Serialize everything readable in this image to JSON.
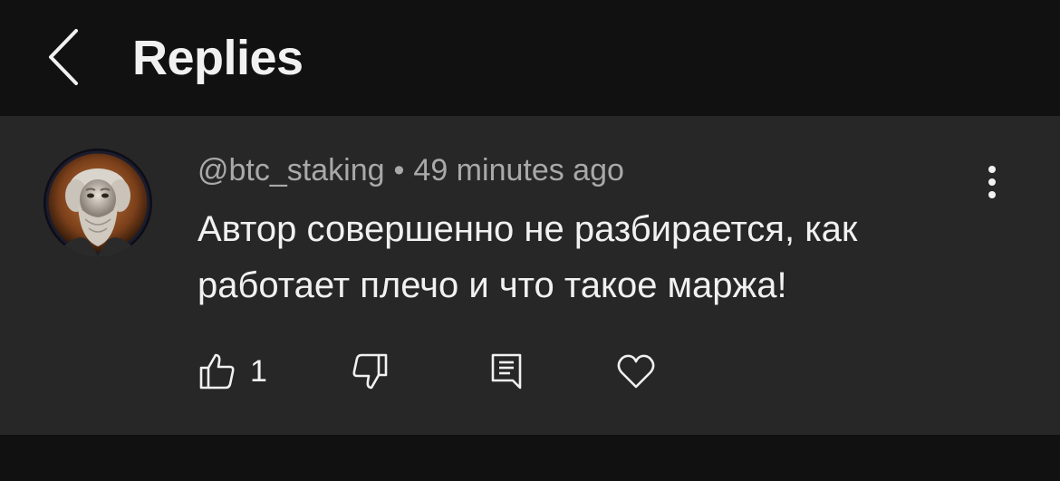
{
  "header": {
    "title": "Replies",
    "back_icon": "chevron-left-icon"
  },
  "comment": {
    "username": "@btc_staking",
    "separator": "•",
    "timestamp": "49 minutes ago",
    "text": "Автор совершенно не разбирается, как работает плечо и что такое маржа!",
    "like_count": "1",
    "avatar_icon": "user-avatar",
    "more_icon": "more-vertical-icon",
    "actions": {
      "like_icon": "thumbs-up-icon",
      "dislike_icon": "thumbs-down-icon",
      "reply_icon": "reply-icon",
      "heart_icon": "heart-icon"
    }
  },
  "colors": {
    "background": "#0f0f0f",
    "card": "#272727",
    "text_primary": "#f1f1f1",
    "text_secondary": "#a9a9a9"
  }
}
